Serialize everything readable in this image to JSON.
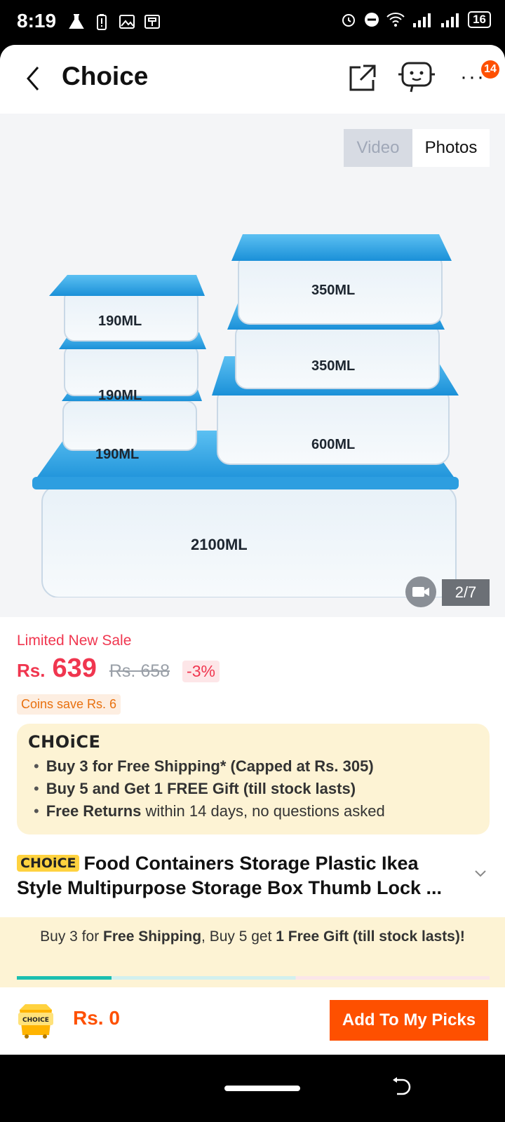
{
  "status_bar": {
    "time": "8:19",
    "battery": "16",
    "icons": [
      "flask-icon",
      "battery-alert-icon",
      "image-icon",
      "sim-icon",
      "alarm-icon",
      "dnd-icon",
      "wifi-icon",
      "signal-icon",
      "signal-icon"
    ]
  },
  "app_bar": {
    "title": "Choice",
    "badge_count": "14",
    "icons": [
      "back-arrow-icon",
      "share-icon",
      "assistant-bot-icon",
      "more-icon"
    ]
  },
  "gallery": {
    "toggle_video": "Video",
    "toggle_photos": "Photos",
    "counter": "2/7",
    "image_labels": [
      "350ML",
      "350ML",
      "600ML",
      "190ML",
      "190ML",
      "190ML",
      "2100ML"
    ]
  },
  "product": {
    "sale_label": "Limited New Sale",
    "currency": "Rs.",
    "price": "639",
    "original_price": "Rs. 658",
    "discount": "-3%",
    "coins": "Coins save Rs. 6",
    "choice_logo": "CHOiCE",
    "perks": [
      {
        "bold": "Buy 3 for  Free Shipping* (Capped at Rs. 305)",
        "rest": ""
      },
      {
        "bold": "Buy 5 and Get 1 FREE Gift (till stock lasts)",
        "rest": ""
      },
      {
        "bold": "Free Returns",
        "rest": " within 14 days, no questions asked"
      }
    ],
    "title_tag": "CHOiCE",
    "title": "Food Containers Storage Plastic Ikea Style Multipurpose Storage Box Thumb Lock ..."
  },
  "promo": {
    "part1": "Buy 3 for ",
    "part2": "Free Shipping",
    "part3": ", Buy 5 get ",
    "part4": "1 Free Gift (till stock lasts)!",
    "progress_fraction": 0.2
  },
  "bottom_bar": {
    "cart_label": "CHOICE",
    "total": "Rs. 0",
    "add_button": "Add To My Picks"
  },
  "colors": {
    "accent": "#fe5000",
    "price": "#f0364f",
    "choice_bg": "#fdf3d4",
    "progress": "#1bbfb0"
  }
}
